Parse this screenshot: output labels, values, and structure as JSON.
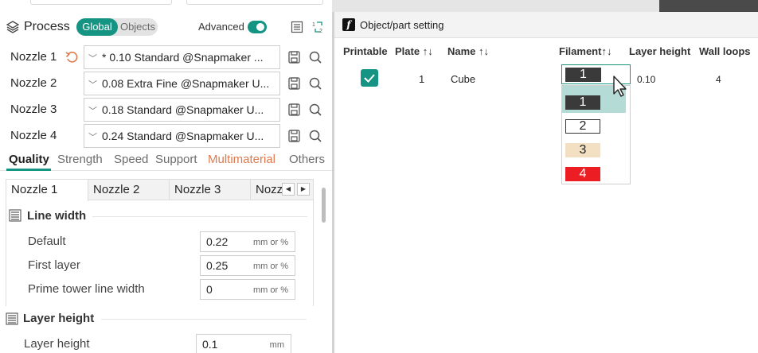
{
  "process": {
    "title": "Process",
    "tabs": [
      "Global",
      "Objects"
    ],
    "advanced_label": "Advanced"
  },
  "nozzles": [
    {
      "label": "Nozzle 1",
      "preset": "* 0.10 Standard @Snapmaker ..."
    },
    {
      "label": "Nozzle 2",
      "preset": "0.08 Extra Fine @Snapmaker U..."
    },
    {
      "label": "Nozzle 3",
      "preset": "0.18 Standard @Snapmaker U..."
    },
    {
      "label": "Nozzle 4",
      "preset": "0.24 Standard @Snapmaker U..."
    }
  ],
  "quality_tabs": [
    "Quality",
    "Strength",
    "Speed",
    "Support",
    "Multimaterial",
    "Others"
  ],
  "nozzle_tabs": [
    "Nozzle 1",
    "Nozzle 2",
    "Nozzle 3",
    "Nozz"
  ],
  "sections": {
    "line_width": {
      "title": "Line width",
      "options": [
        {
          "label": "Default",
          "value": "0.22",
          "unit": "mm or %"
        },
        {
          "label": "First layer",
          "value": "0.25",
          "unit": "mm or %"
        },
        {
          "label": "Prime tower line width",
          "value": "0",
          "unit": "mm or %"
        }
      ]
    },
    "layer_height": {
      "title": "Layer height",
      "options": [
        {
          "label": "Layer height",
          "value": "0.1",
          "unit": "mm"
        }
      ]
    }
  },
  "dialog": {
    "title": "Object/part setting",
    "columns": [
      "Printable",
      "Plate",
      "Name",
      "Filament",
      "Layer height",
      "Wall loops"
    ],
    "sort_arrows": "↑↓",
    "row": {
      "plate": "1",
      "name": "Cube",
      "filament": "1",
      "layer_height": "0.10",
      "wall_loops": "4"
    },
    "filament_options": [
      {
        "label": "1",
        "color": "#3a3a3a",
        "text_color": "#ffffff"
      },
      {
        "label": "2",
        "color": "#ffffff",
        "text_color": "#222222"
      },
      {
        "label": "3",
        "color": "#f3e0c2",
        "text_color": "#222222"
      },
      {
        "label": "4",
        "color": "#ec1e24",
        "text_color": "#ffffff"
      }
    ]
  },
  "colors": {
    "accent": "#159383",
    "multimaterial": "#e07a4c"
  }
}
